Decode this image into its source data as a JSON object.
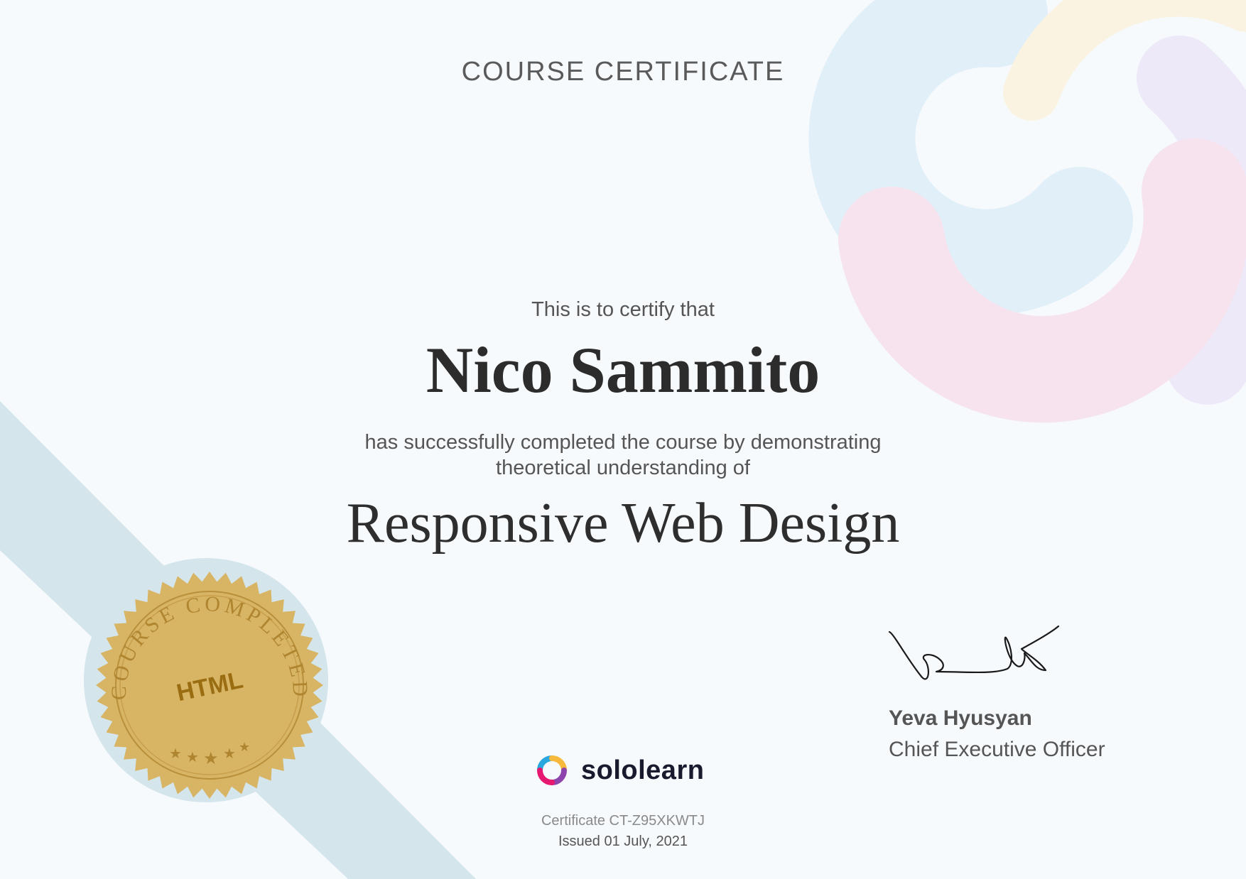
{
  "header": {
    "title": "COURSE CERTIFICATE"
  },
  "body": {
    "certify_text": "This is to certify that",
    "recipient_name": "Nico Sammito",
    "description_line1": "has successfully completed the course by demonstrating",
    "description_line2": "theoretical understanding of",
    "course_name": "Responsive Web Design"
  },
  "seal": {
    "ring_text": "COURSE COMPLETED",
    "center_text": "HTML",
    "icon": "gold-seal-icon"
  },
  "signer": {
    "name": "Yeva Hyusyan",
    "title": "Chief Executive Officer",
    "icon": "signature-icon"
  },
  "brand": {
    "name": "sololearn",
    "icon": "sololearn-logo-icon"
  },
  "footer": {
    "certificate_id": "Certificate CT-Z95XKWTJ",
    "issued": "Issued 01 July, 2021"
  },
  "colors": {
    "background": "#f6fafd",
    "ribbon": "#d4e5eb",
    "seal_gold": "#d8b565",
    "seal_text": "#9a6d12",
    "arc_blue": "#e1eff8",
    "arc_pink": "#f7e3ee",
    "arc_yellow": "#fbf3e2",
    "arc_purple": "#eee9f8"
  }
}
